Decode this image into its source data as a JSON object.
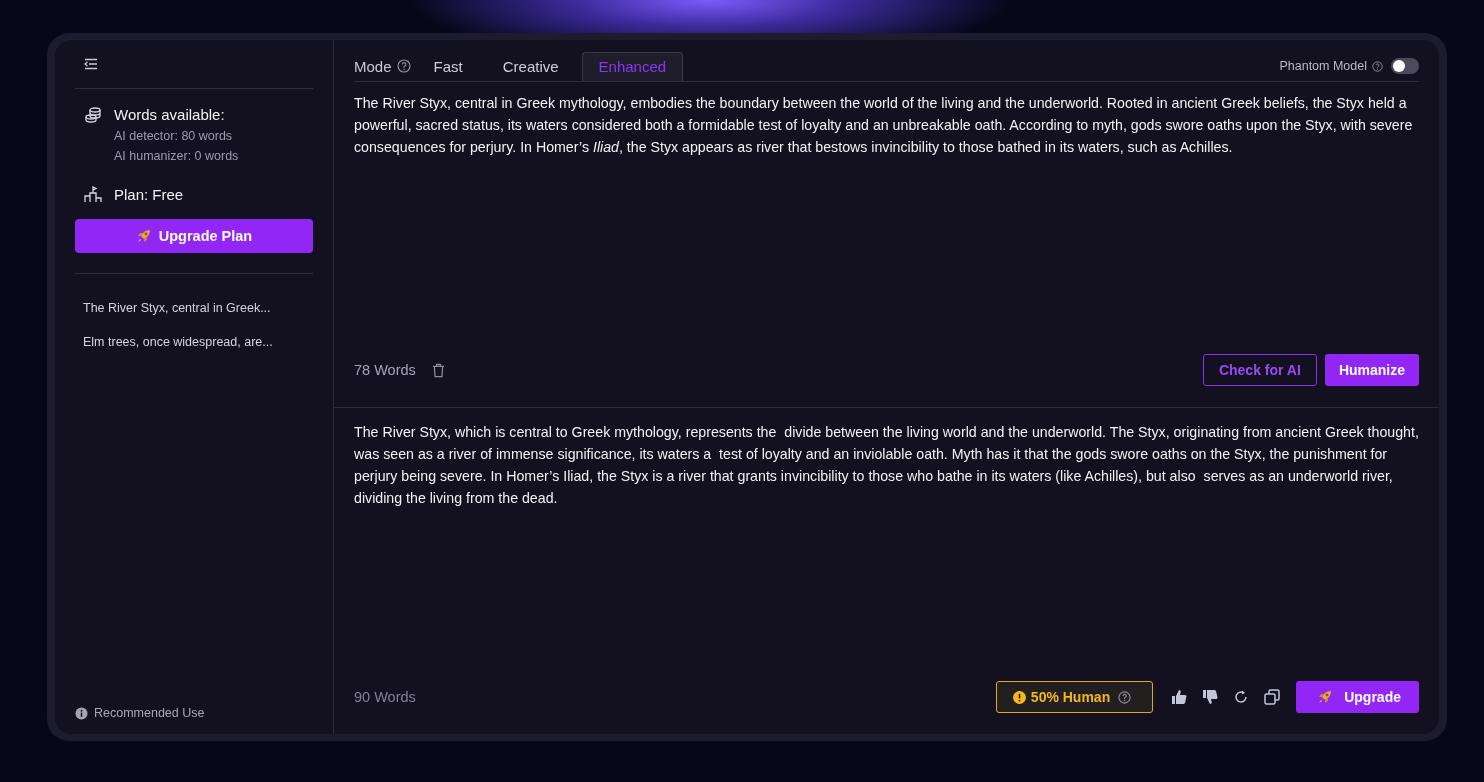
{
  "sidebar": {
    "words_title": "Words available:",
    "words_lines": [
      "AI detector: 80 words",
      "AI humanizer: 0 words"
    ],
    "plan": "Plan: Free",
    "upgrade_button": "Upgrade Plan",
    "history": [
      "The River Styx, central in Greek...",
      "Elm trees, once widespread, are..."
    ],
    "footer_link": "Recommended Use"
  },
  "mode": {
    "label": "Mode",
    "tabs": [
      {
        "label": "Fast",
        "selected": false
      },
      {
        "label": "Creative",
        "selected": false
      },
      {
        "label": "Enhanced",
        "selected": true
      }
    ]
  },
  "phantom": {
    "label": "Phantom Model",
    "on": false
  },
  "input": {
    "text": "The River Styx, central in Greek mythology, embodies the boundary between the world of the living and the underworld. Rooted in ancient Greek beliefs, the Styx held a powerful, sacred status, its waters considered both a formidable test of loyalty and an unbreakable oath. According to myth, gods swore oaths upon the Styx, with severe consequences for perjury. In Homer’s *Iliad*, the Styx appears as river that bestows invincibility to those bathed in its waters, such as Achilles.",
    "word_count": "78 Words",
    "check_button": "Check for AI",
    "humanize_button": "Humanize"
  },
  "output": {
    "text": "The River Styx, which is central to Greek mythology, represents the  divide between the living world and the underworld. The Styx, originating from ancient Greek thought, was seen as a river of immense significance, its waters a  test of loyalty and an inviolable oath. Myth has it that the gods swore oaths on the Styx, the punishment for  perjury being severe. In Homer’s Iliad, the Styx is a river that grants invincibility to those who bathe in its waters (like Achilles), but also  serves as an underworld river, dividing the living from the dead.",
    "word_count": "90 Words",
    "score": "50% Human",
    "upgrade_button": "Upgrade"
  }
}
